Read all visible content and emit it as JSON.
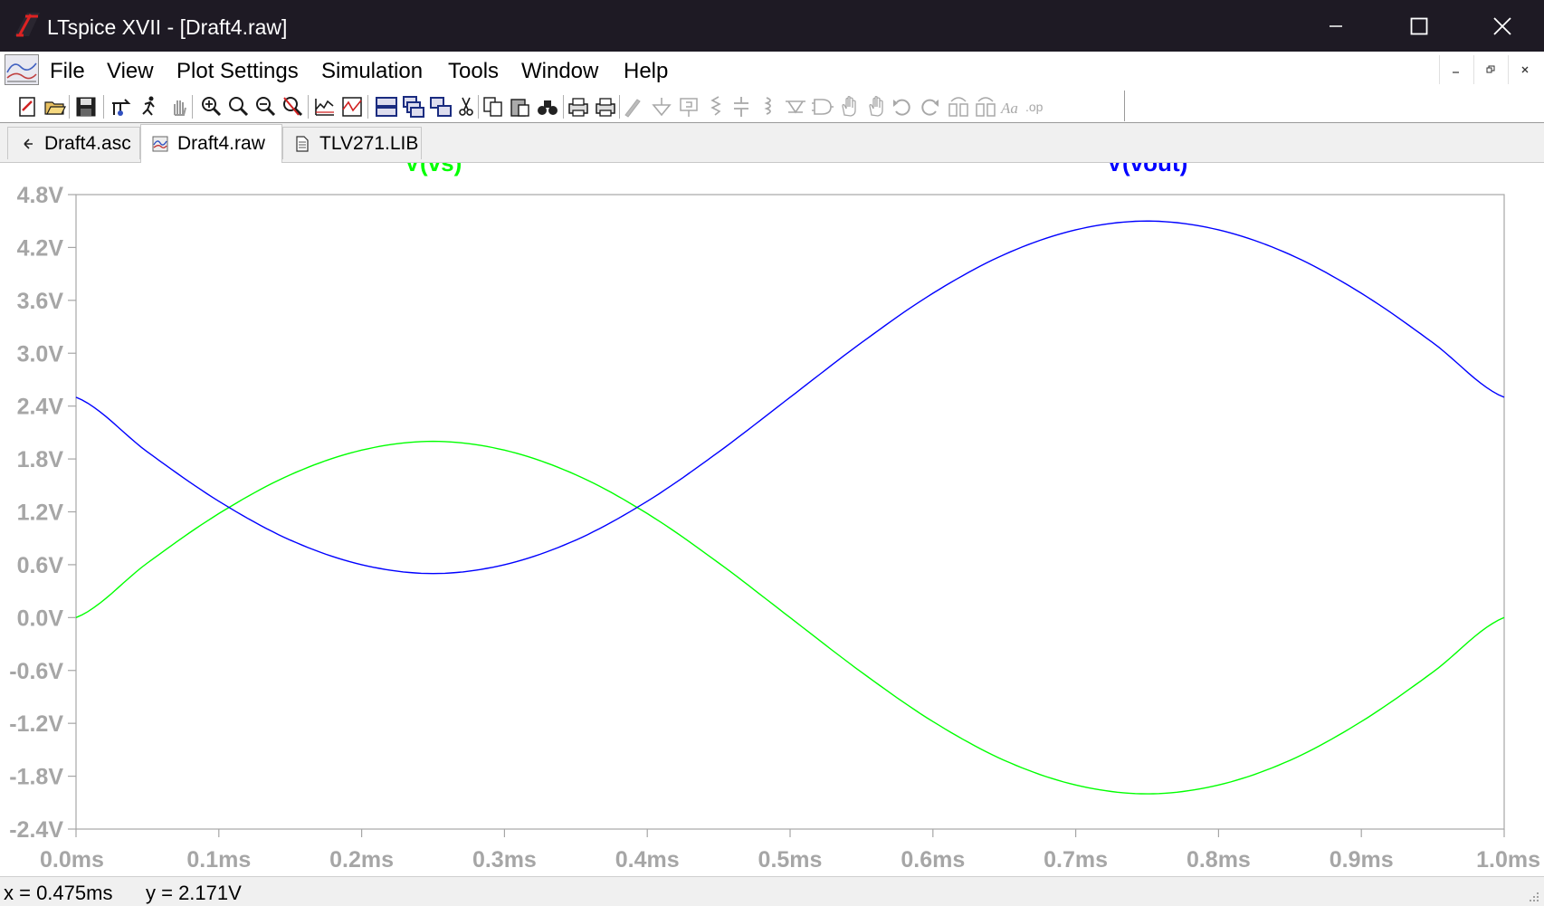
{
  "window": {
    "title": "LTspice XVII - [Draft4.raw]"
  },
  "menu": {
    "file": "File",
    "view": "View",
    "plot_settings": "Plot Settings",
    "simulation": "Simulation",
    "tools": "Tools",
    "window": "Window",
    "help": "Help"
  },
  "toolbar": {
    "icons": [
      "new-schematic-icon",
      "open-icon",
      "save-icon",
      "control-panel-icon",
      "run-icon",
      "halt-icon",
      "zoom-in-icon",
      "zoom-area-icon",
      "zoom-out-icon",
      "zoom-fit-icon",
      "autorange-icon",
      "add-trace-icon",
      "tile-horizontal-icon",
      "cascade-icon",
      "tile-vertical-icon",
      "cut-icon",
      "copy-icon",
      "paste-icon",
      "find-icon",
      "print-icon",
      "print-setup-icon",
      "wire-icon",
      "ground-icon",
      "label-icon",
      "resistor-icon",
      "capacitor-icon",
      "inductor-icon",
      "diode-icon",
      "component-icon",
      "move-icon",
      "drag-icon",
      "undo-icon",
      "redo-icon",
      "rotate-icon",
      "mirror-icon",
      "text-icon",
      "spice-directive-icon"
    ]
  },
  "tabs": [
    {
      "label": "Draft4.asc",
      "icon": "schematic-tab-icon",
      "active": false
    },
    {
      "label": "Draft4.raw",
      "icon": "waveform-tab-icon",
      "active": true
    },
    {
      "label": "TLV271.LIB",
      "icon": "document-tab-icon",
      "active": false
    }
  ],
  "chart_data": {
    "type": "line",
    "xlabel": "",
    "ylabel": "",
    "xlim": [
      0.0,
      1.0
    ],
    "ylim": [
      -2.4,
      4.8
    ],
    "x_unit": "ms",
    "y_unit": "V",
    "x_tick_labels": [
      "0.0ms",
      "0.1ms",
      "0.2ms",
      "0.3ms",
      "0.4ms",
      "0.5ms",
      "0.6ms",
      "0.7ms",
      "0.8ms",
      "0.9ms",
      "1.0ms"
    ],
    "y_tick_labels": [
      "4.8V",
      "4.2V",
      "3.6V",
      "3.0V",
      "2.4V",
      "1.8V",
      "1.2V",
      "0.6V",
      "0.0V",
      "-0.6V",
      "-1.2V",
      "-1.8V",
      "-2.4V"
    ],
    "grid": false,
    "legend": "top",
    "x": [
      0.0,
      0.05,
      0.1,
      0.15,
      0.2,
      0.25,
      0.3,
      0.35,
      0.4,
      0.45,
      0.5,
      0.55,
      0.6,
      0.65,
      0.7,
      0.75,
      0.8,
      0.85,
      0.9,
      0.95,
      1.0
    ],
    "series": [
      {
        "name": "V(vs)",
        "color": "#00ff00",
        "values": [
          0.0,
          0.62,
          1.18,
          1.62,
          1.9,
          2.0,
          1.9,
          1.62,
          1.18,
          0.62,
          0.0,
          -0.62,
          -1.18,
          -1.62,
          -1.9,
          -2.0,
          -1.9,
          -1.62,
          -1.18,
          -0.62,
          0.0
        ]
      },
      {
        "name": "V(vout)",
        "color": "#0000ff",
        "values": [
          2.5,
          1.88,
          1.32,
          0.88,
          0.6,
          0.5,
          0.6,
          0.88,
          1.32,
          1.88,
          2.5,
          3.12,
          3.68,
          4.12,
          4.4,
          4.5,
          4.4,
          4.12,
          3.68,
          3.12,
          2.5
        ]
      }
    ]
  },
  "status": {
    "x_readout": "x = 0.475ms",
    "y_readout": "y = 2.171V"
  }
}
